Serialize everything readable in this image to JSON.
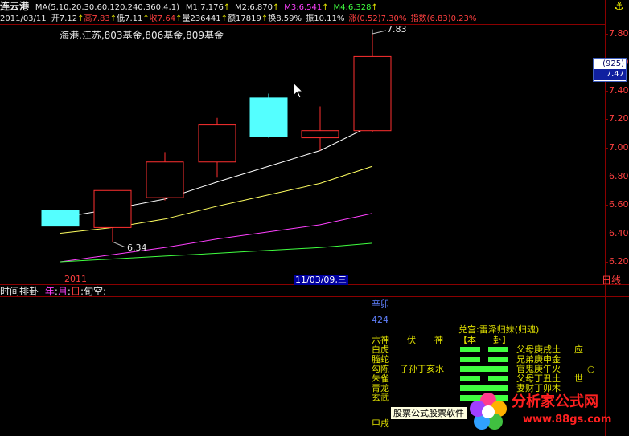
{
  "header": {
    "title": "连云港",
    "ma_label": "MA(5,10,20,30,60,120,240,360,4,1)",
    "m1": "M1:7.176",
    "m2": "M2:6.870",
    "m3": "M3:6.541",
    "m4": "M4:6.328",
    "date": "2011/03/11",
    "open": "开7.12",
    "high": "高7.83",
    "low": "低7.11",
    "close": "收7.64",
    "volume": "量236441",
    "amount": "额17819",
    "turnover": "换8.59%",
    "amplitude": "振10.11%",
    "change": "涨(0.52)7.30%",
    "index": "指数(6.83)0.23%",
    "corner_icon": "anchor-icon"
  },
  "concepts": "海港,江苏,803基金,806基金,809基金",
  "annotations": {
    "high_label": "7.83",
    "low_label": "6.34"
  },
  "price_axis": {
    "ticks": [
      "7.80",
      "7.60",
      "7.40",
      "7.20",
      "7.00",
      "6.80",
      "6.60",
      "6.40",
      "6.20"
    ],
    "badge_top": "(925)",
    "badge_bottom": "7.47"
  },
  "time_axis": {
    "year_label": "2011",
    "cursor_label": "11/03/09,三",
    "right_label": "日线"
  },
  "lower_panel": {
    "title": "时间排卦",
    "year": "年",
    "month": "月",
    "day": "日",
    "xunkong": "旬空:",
    "ganzhi": "辛卯",
    "number": "424",
    "gua_title": "兑宫:雷泽归妹(归魂)",
    "col_liushen": "六神",
    "col_fushen_1": "伏",
    "col_fushen_2": "神",
    "col_ben_1": "【本",
    "col_ben_2": "卦】",
    "liushen": [
      "白虎",
      "螣蛇",
      "勾陈",
      "朱雀",
      "青龙",
      "玄武"
    ],
    "fushen": [
      "",
      "",
      "子孙丁亥水",
      "",
      "",
      ""
    ],
    "lines": [
      "父母庚戌土",
      "兄弟庚申金",
      "官鬼庚午火",
      "父母丁丑土",
      "妻财丁卯木",
      ""
    ],
    "marks": [
      "应",
      "",
      "○",
      "世",
      "",
      ""
    ],
    "yao": [
      "yin",
      "yin",
      "yang",
      "yin",
      "yang",
      "yang"
    ],
    "bottom_label": "甲戌"
  },
  "watermark": {
    "tooltip": "股票公式股票软件",
    "logo_text": "分析家公式网",
    "logo_url": "www.88gs.com"
  },
  "colors": {
    "up": "#ff3030",
    "down": "#54ffff",
    "ma1": "#ffffff",
    "ma2": "#ffff60",
    "ma3": "#ff40ff",
    "ma4": "#40ff40"
  },
  "candles": [
    {
      "open": 6.56,
      "high": 6.56,
      "low": 6.45,
      "close": 6.45
    },
    {
      "open": 6.44,
      "high": 6.7,
      "low": 6.34,
      "close": 6.7
    },
    {
      "open": 6.65,
      "high": 6.97,
      "low": 6.63,
      "close": 6.9
    },
    {
      "open": 6.9,
      "high": 7.21,
      "low": 6.79,
      "close": 7.16
    },
    {
      "open": 7.35,
      "high": 7.38,
      "low": 7.07,
      "close": 7.08
    },
    {
      "open": 7.07,
      "high": 7.29,
      "low": 6.98,
      "close": 7.12
    },
    {
      "open": 7.12,
      "high": 7.83,
      "low": 7.11,
      "close": 7.64
    }
  ],
  "ma_lines": [
    [
      6.51,
      6.57,
      6.64,
      6.76,
      6.87,
      6.98,
      7.16
    ],
    [
      6.4,
      6.44,
      6.5,
      6.59,
      6.67,
      6.75,
      6.87
    ],
    [
      6.2,
      6.25,
      6.3,
      6.36,
      6.41,
      6.46,
      6.54
    ],
    [
      6.2,
      6.22,
      6.24,
      6.26,
      6.28,
      6.3,
      6.33
    ]
  ]
}
